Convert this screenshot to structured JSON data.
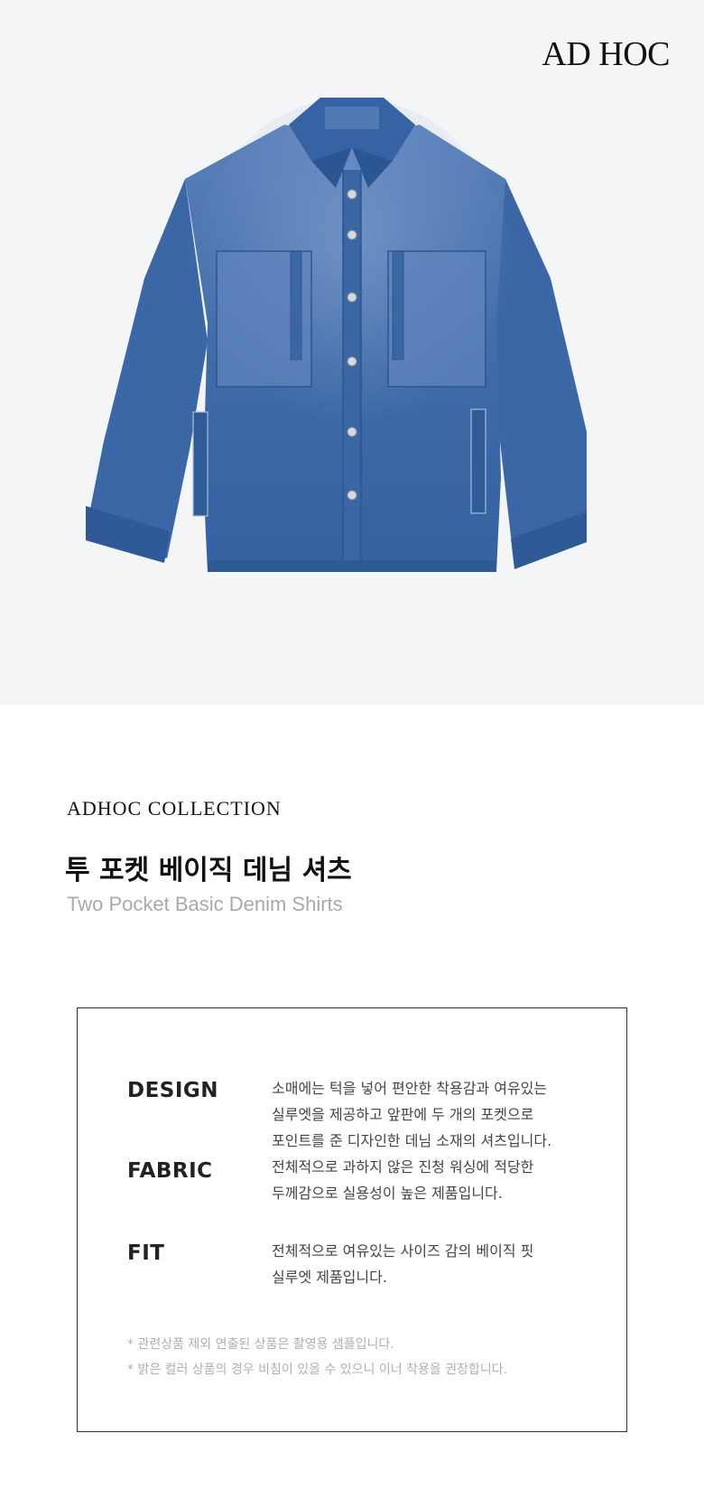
{
  "brand": "AD HOC",
  "product": {
    "collection": "ADHOC COLLECTION",
    "title_ko": "투 포켓 베이직 데님 셔츠",
    "title_en": "Two Pocket Basic Denim Shirts"
  },
  "details": {
    "design": {
      "label": "DESIGN",
      "text": "소매에는 턱을 넣어 편안한 착용감과 여유있는\n실루엣을 제공하고 앞판에 두 개의 포켓으로\n포인트를 준 디자인한 데님 소재의 셔츠입니다."
    },
    "fabric": {
      "label": "FABRIC",
      "text": "전체적으로 과하지 않은 진청 워싱에 적당한\n두께감으로 실용성이 높은 제품입니다."
    },
    "fit": {
      "label": "FIT",
      "text": "전체적으로 여유있는 사이즈 감의 베이직 핏\n실루엣 제품입니다."
    }
  },
  "notes": [
    "* 관련상품 제외 연출된 상품은 촬영용 샘플입니다.",
    "* 밝은 컬러 상품의 경우 비침이 있을 수 있으니 이너 착용을 권장합니다."
  ],
  "image": {
    "subject": "denim-shirt",
    "colors": {
      "background": "#f4f5f7",
      "denim": "#3f6aa8",
      "denim_dark": "#2e5590",
      "denim_light": "#6b8fc4"
    }
  }
}
